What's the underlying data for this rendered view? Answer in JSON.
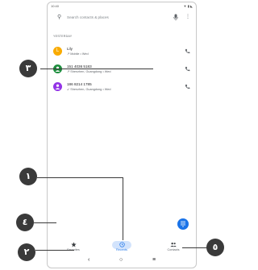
{
  "status_bar": {
    "time": "10:40",
    "indicators": "▼ ▮ ◣"
  },
  "search": {
    "placeholder": "Search contacts & places",
    "more": "⋮"
  },
  "section_label": "YESTERDAY",
  "recents": [
    {
      "name": "Lily",
      "detail": "↗ Mobile • Wed",
      "avatar_letter": "L",
      "avatar_color": "#f9ab00"
    },
    {
      "name": "151 4036 5183",
      "detail": "↗ Shenzhen, Guangdong • Wed",
      "avatar_letter": "",
      "avatar_color": "#1e8e3e"
    },
    {
      "name": "186 8214 1785",
      "detail": "↙ Shenzhen, Guangdong • Wed",
      "avatar_letter": "",
      "avatar_color": "#9334e6"
    }
  ],
  "bottom_nav": [
    {
      "label": "Favorites",
      "icon": "star-icon"
    },
    {
      "label": "Recents",
      "icon": "clock-icon"
    },
    {
      "label": "Contacts",
      "icon": "people-icon"
    }
  ],
  "system_nav": {
    "back": "‹",
    "home": "○",
    "recents": "≡"
  },
  "callouts": [
    "١",
    "٢",
    "٣",
    "٤",
    "٥"
  ],
  "colors": {
    "accent": "#1a73e8",
    "callout": "#3a3a3a"
  }
}
